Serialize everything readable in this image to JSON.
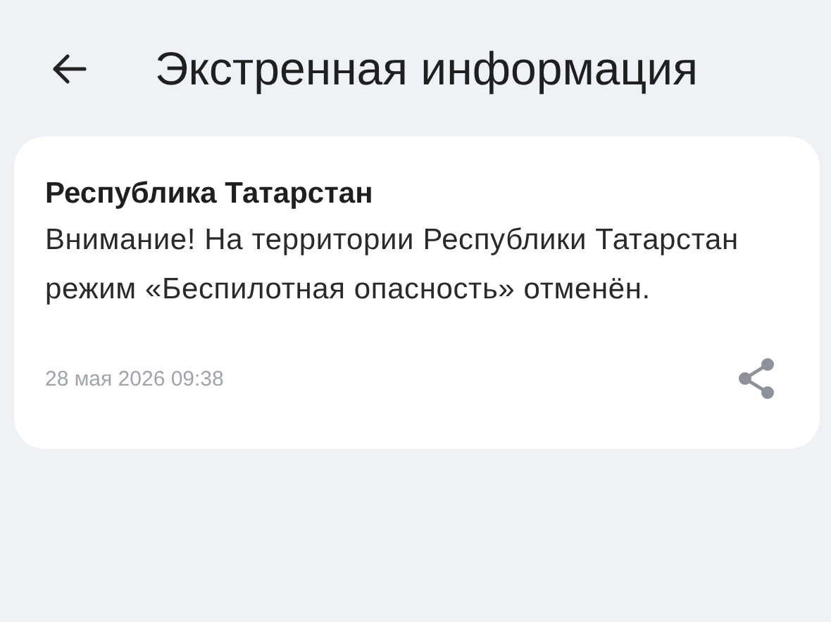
{
  "header": {
    "title": "Экстренная информация"
  },
  "message": {
    "sender": "Республика Татарстан",
    "text": "Внимание! На территории Республики Татарстан режим «Беспилотная опасность» отменён.",
    "date": "28 мая 2026 09:38"
  }
}
